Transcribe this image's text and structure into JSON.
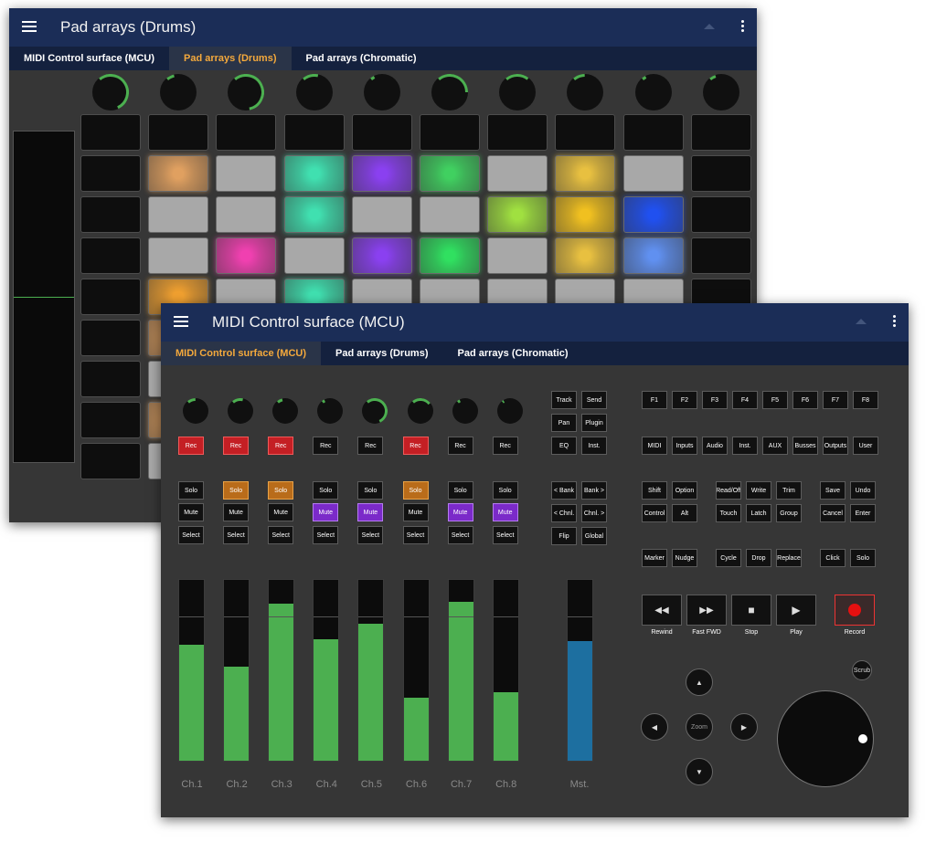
{
  "back_window": {
    "title": "Pad arrays (Drums)",
    "tabs": [
      {
        "label": "MIDI Control surface (MCU)",
        "active": false
      },
      {
        "label": "Pad arrays (Drums)",
        "active": true
      },
      {
        "label": "Pad arrays (Chromatic)",
        "active": false
      }
    ],
    "knob_levels": [
      0.75,
      0.1,
      0.8,
      0.2,
      0.05,
      0.5,
      0.3,
      0.15,
      0.05,
      0.08
    ],
    "pad_grid": [
      [
        "off",
        "off",
        "off",
        "off",
        "off",
        "off",
        "off",
        "off",
        "off",
        "off"
      ],
      [
        "off",
        "#e0a060",
        "#a8a8a8",
        "#40e0b0",
        "#8a40f0",
        "#40d060",
        "#a8a8a8",
        "#e8c040",
        "#a8a8a8",
        "off"
      ],
      [
        "off",
        "#a8a8a8",
        "#a8a8a8",
        "#40e0b0",
        "#a8a8a8",
        "#a8a8a8",
        "#a0e040",
        "#f0c020",
        "#2050f0",
        "off"
      ],
      [
        "off",
        "#a8a8a8",
        "#f040b0",
        "#a8a8a8",
        "#8a40f0",
        "#30e060",
        "#a8a8a8",
        "#e8c040",
        "#6090f0",
        "off"
      ],
      [
        "off",
        "#f0a030",
        "#a8a8a8",
        "#40e0b0",
        "#a8a8a8",
        "#a8a8a8",
        "#a8a8a8",
        "#a8a8a8",
        "#a8a8a8",
        "off"
      ],
      [
        "off",
        "#e0a060",
        "#a8a8a8",
        "#a8a8a8",
        "#a8a8a8",
        "#a8a8a8",
        "#a8a8a8",
        "#a8a8a8",
        "#a8a8a8",
        "off"
      ],
      [
        "off",
        "#a8a8a8",
        "#a8a8a8",
        "#a8a8a8",
        "#a8a8a8",
        "#a8a8a8",
        "#a8a8a8",
        "#a8a8a8",
        "#a8a8a8",
        "off"
      ],
      [
        "off",
        "#e0a060",
        "#a8a8a8",
        "#a8a8a8",
        "#a8a8a8",
        "#a8a8a8",
        "#a8a8a8",
        "#a8a8a8",
        "#a8a8a8",
        "off"
      ],
      [
        "off",
        "#a8a8a8",
        "#a8a8a8",
        "#a8a8a8",
        "#a8a8a8",
        "#a8a8a8",
        "#a8a8a8",
        "#a8a8a8",
        "#a8a8a8",
        "off"
      ]
    ]
  },
  "front_window": {
    "title": "MIDI Control surface (MCU)",
    "tabs": [
      {
        "label": "MIDI Control surface (MCU)",
        "active": true
      },
      {
        "label": "Pad arrays (Drums)",
        "active": false
      },
      {
        "label": "Pad arrays (Chromatic)",
        "active": false
      }
    ],
    "channels": [
      {
        "label": "Ch.1",
        "knob": 0.15,
        "rec": true,
        "solo": false,
        "mute": false,
        "fader": 0.64
      },
      {
        "label": "Ch.2",
        "knob": 0.2,
        "rec": true,
        "solo": true,
        "mute": false,
        "fader": 0.52
      },
      {
        "label": "Ch.3",
        "knob": 0.1,
        "rec": true,
        "solo": true,
        "mute": false,
        "fader": 0.87
      },
      {
        "label": "Ch.4",
        "knob": 0.05,
        "rec": false,
        "solo": false,
        "mute": true,
        "fader": 0.67
      },
      {
        "label": "Ch.5",
        "knob": 0.75,
        "rec": false,
        "solo": false,
        "mute": true,
        "fader": 0.76
      },
      {
        "label": "Ch.6",
        "knob": 0.35,
        "rec": true,
        "solo": true,
        "mute": false,
        "fader": 0.35
      },
      {
        "label": "Ch.7",
        "knob": 0.05,
        "rec": false,
        "solo": false,
        "mute": true,
        "fader": 0.88
      },
      {
        "label": "Ch.8",
        "knob": 0.03,
        "rec": false,
        "solo": false,
        "mute": true,
        "fader": 0.38
      }
    ],
    "rec_label": "Rec",
    "solo_label": "Solo",
    "mute_label": "Mute",
    "select_label": "Select",
    "master": {
      "label": "Mst.",
      "fader": 0.66,
      "color": "#1d6fa0"
    },
    "assign_buttons": [
      "Track",
      "Send",
      "Pan",
      "Plugin",
      "EQ",
      "Inst."
    ],
    "bank_buttons": [
      "< Bank",
      "Bank >",
      "< Chnl.",
      "Chnl. >",
      "Flip",
      "Global"
    ],
    "f_keys": [
      "F1",
      "F2",
      "F3",
      "F4",
      "F5",
      "F6",
      "F7",
      "F8"
    ],
    "view_buttons": [
      "MIDI",
      "Inputs",
      "Audio",
      "Inst.",
      "AUX",
      "Busses",
      "Outputs",
      "User"
    ],
    "modifier_buttons": [
      "Shift",
      "Option",
      "Control",
      "Alt"
    ],
    "automation_buttons": [
      "Read/Off",
      "Write",
      "Trim",
      "Touch",
      "Latch",
      "Group"
    ],
    "utility_buttons": [
      "Save",
      "Undo",
      "Cancel",
      "Enter"
    ],
    "marker_buttons": [
      "Marker",
      "Nudge"
    ],
    "edit_buttons": [
      "Cycle",
      "Drop",
      "Replace"
    ],
    "click_buttons": [
      "Click",
      "Solo"
    ],
    "transport": [
      {
        "label": "Rewind",
        "glyph": "◀◀"
      },
      {
        "label": "Fast FWD",
        "glyph": "▶▶"
      },
      {
        "label": "Stop",
        "glyph": "■"
      },
      {
        "label": "Play",
        "glyph": "▶"
      }
    ],
    "record_label": "Record",
    "record_color": "#e51010",
    "zoom_label": "Zoom",
    "scrub_label": "Scrub",
    "accent_color": "#f4a93c",
    "header_color": "#1b2d57"
  }
}
